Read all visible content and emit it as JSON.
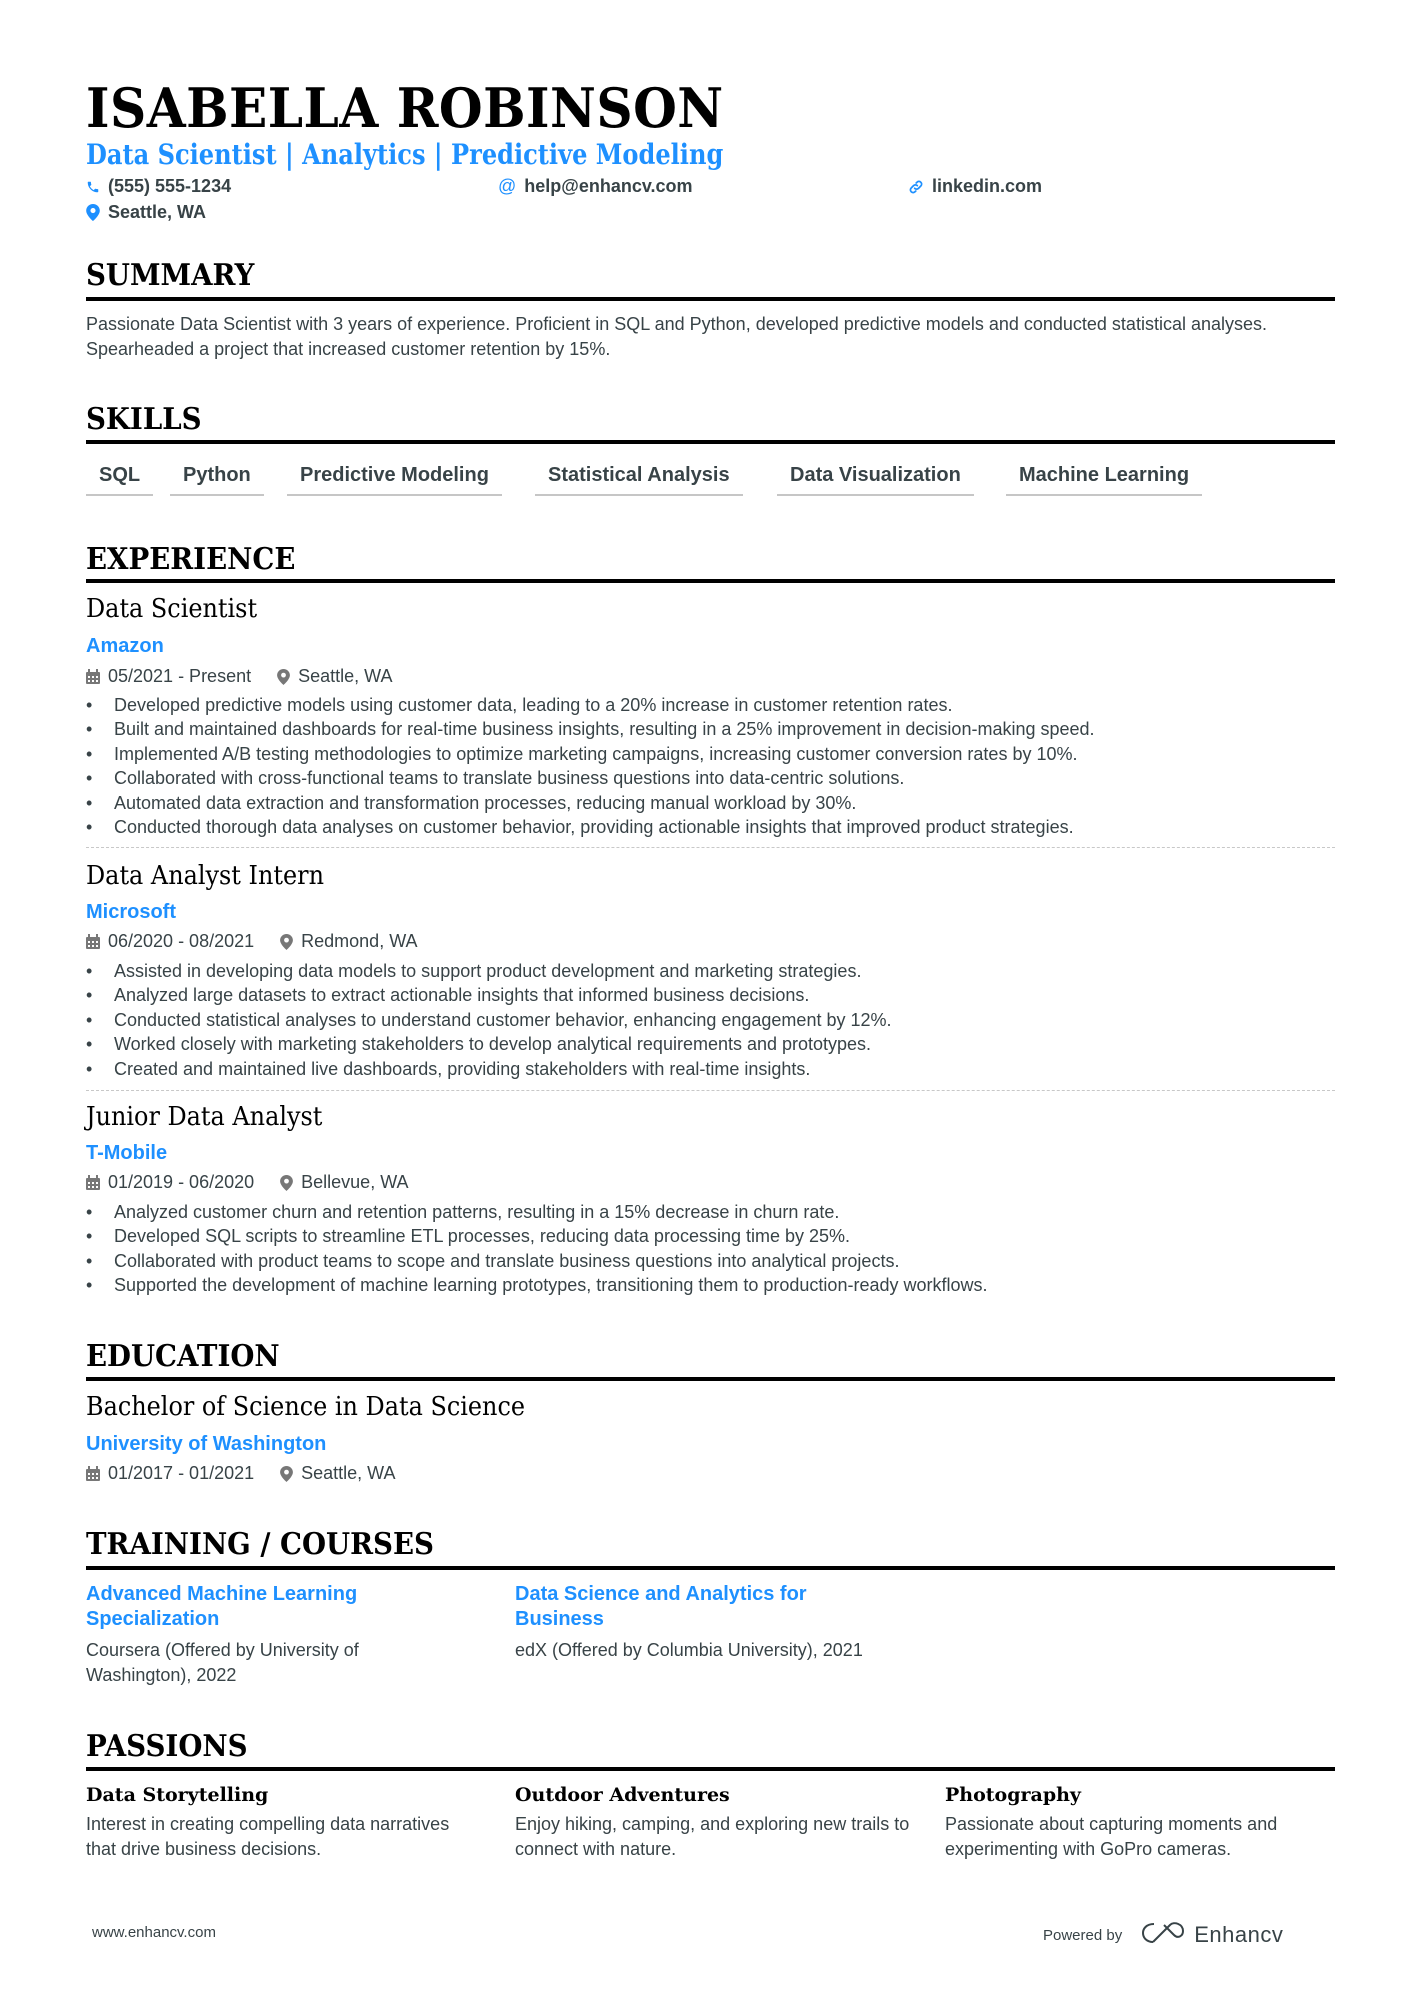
{
  "header": {
    "name": "ISABELLA ROBINSON",
    "subtitle": "Data Scientist | Analytics | Predictive Modeling",
    "phone": "(555) 555-1234",
    "email": "help@enhancv.com",
    "linkedin": "linkedin.com",
    "location": "Seattle, WA",
    "icons": {
      "phone": "phone-icon",
      "email": "at-icon",
      "linkedin": "link-icon",
      "location": "map-pin-icon"
    }
  },
  "colors": {
    "accent": "#1e90ff",
    "text": "#384347",
    "heading": "#000000"
  },
  "summary": {
    "title": "SUMMARY",
    "text": "Passionate Data Scientist with 3 years of experience. Proficient in SQL and Python, developed predictive models and conducted statistical analyses. Spearheaded a project that increased customer retention by 15%."
  },
  "skills": {
    "title": "SKILLS",
    "items": [
      "SQL",
      "Python",
      "Predictive Modeling",
      "Statistical Analysis",
      "Data Visualization",
      "Machine Learning"
    ]
  },
  "experience": {
    "title": "EXPERIENCE",
    "jobs": [
      {
        "title": "Data Scientist",
        "company": "Amazon",
        "dates": "05/2021 - Present",
        "location": "Seattle, WA",
        "bullets": [
          "Developed predictive models using customer data, leading to a 20% increase in customer retention rates.",
          "Built and maintained dashboards for real-time business insights, resulting in a 25% improvement in decision-making speed.",
          "Implemented A/B testing methodologies to optimize marketing campaigns, increasing customer conversion rates by 10%.",
          "Collaborated with cross-functional teams to translate business questions into data-centric solutions.",
          "Automated data extraction and transformation processes, reducing manual workload by 30%.",
          "Conducted thorough data analyses on customer behavior, providing actionable insights that improved product strategies."
        ]
      },
      {
        "title": "Data Analyst Intern",
        "company": "Microsoft",
        "dates": "06/2020 - 08/2021",
        "location": "Redmond, WA",
        "bullets": [
          "Assisted in developing data models to support product development and marketing strategies.",
          "Analyzed large datasets to extract actionable insights that informed business decisions.",
          "Conducted statistical analyses to understand customer behavior, enhancing engagement by 12%.",
          "Worked closely with marketing stakeholders to develop analytical requirements and prototypes.",
          "Created and maintained live dashboards, providing stakeholders with real-time insights."
        ]
      },
      {
        "title": "Junior Data Analyst",
        "company": "T-Mobile",
        "dates": "01/2019 - 06/2020",
        "location": "Bellevue, WA",
        "bullets": [
          "Analyzed customer churn and retention patterns, resulting in a 15% decrease in churn rate.",
          "Developed SQL scripts to streamline ETL processes, reducing data processing time by 25%.",
          "Collaborated with product teams to scope and translate business questions into analytical projects.",
          "Supported the development of machine learning prototypes, transitioning them to production-ready workflows."
        ]
      }
    ]
  },
  "education": {
    "title": "EDUCATION",
    "degree": "Bachelor of Science in Data Science",
    "school": "University of Washington",
    "dates": "01/2017 - 01/2021",
    "location": "Seattle, WA"
  },
  "training": {
    "title": "TRAINING / COURSES",
    "courses": [
      {
        "title": "Advanced Machine Learning Specialization",
        "desc": "Coursera (Offered by University of Washington), 2022"
      },
      {
        "title": "Data Science and Analytics for Business",
        "desc": "edX (Offered by Columbia University), 2021"
      }
    ]
  },
  "passions": {
    "title": "PASSIONS",
    "items": [
      {
        "title": "Data Storytelling",
        "desc": "Interest in creating compelling data narratives that drive business decisions."
      },
      {
        "title": "Outdoor Adventures",
        "desc": "Enjoy hiking, camping, and exploring new trails to connect with nature."
      },
      {
        "title": "Photography",
        "desc": "Passionate about capturing moments and experimenting with GoPro cameras."
      }
    ]
  },
  "footer": {
    "url": "www.enhancv.com",
    "powered_by": "Powered by",
    "brand": "Enhancv"
  }
}
